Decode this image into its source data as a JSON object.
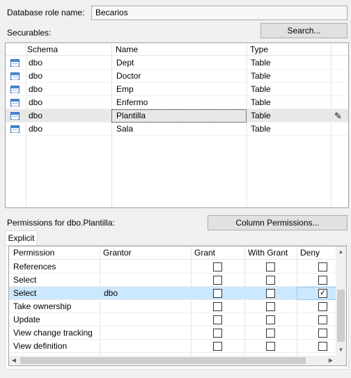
{
  "role_name_label": "Database role name:",
  "role_name_value": "Becarios",
  "securables_label": "Securables:",
  "search_button": "Search...",
  "securables": {
    "columns": [
      "Schema",
      "Name",
      "Type"
    ],
    "rows": [
      {
        "schema": "dbo",
        "name": "Dept",
        "type": "Table",
        "icon": "table-icon"
      },
      {
        "schema": "dbo",
        "name": "Doctor",
        "type": "Table",
        "icon": "table-icon"
      },
      {
        "schema": "dbo",
        "name": "Emp",
        "type": "Table",
        "icon": "table-icon"
      },
      {
        "schema": "dbo",
        "name": "Enfermo",
        "type": "Table",
        "icon": "table-icon"
      },
      {
        "schema": "dbo",
        "name": "Plantilla",
        "type": "Table",
        "icon": "table-icon",
        "selected": true
      },
      {
        "schema": "dbo",
        "name": "Sala",
        "type": "Table",
        "icon": "table-icon"
      }
    ],
    "edit_icon": "pencil-edit-icon"
  },
  "permissions_label": "Permissions for dbo.Plantilla:",
  "column_permissions_button": "Column Permissions...",
  "tab_explicit": "Explicit",
  "permissions": {
    "columns": [
      "Permission",
      "Grantor",
      "Grant",
      "With Grant",
      "Deny"
    ],
    "rows": [
      {
        "permission": "References",
        "grantor": "",
        "grant": false,
        "with_grant": false,
        "deny": false
      },
      {
        "permission": "Select",
        "grantor": "",
        "grant": false,
        "with_grant": false,
        "deny": false
      },
      {
        "permission": "Select",
        "grantor": "dbo",
        "grant": false,
        "with_grant": false,
        "deny": true,
        "selected": true
      },
      {
        "permission": "Take ownership",
        "grantor": "",
        "grant": false,
        "with_grant": false,
        "deny": false
      },
      {
        "permission": "Update",
        "grantor": "",
        "grant": false,
        "with_grant": false,
        "deny": false
      },
      {
        "permission": "View change tracking",
        "grantor": "",
        "grant": false,
        "with_grant": false,
        "deny": false
      },
      {
        "permission": "View definition",
        "grantor": "",
        "grant": false,
        "with_grant": false,
        "deny": false
      }
    ]
  },
  "colors": {
    "selection": "#cce8ff",
    "focus_border": "#99c9ef"
  }
}
